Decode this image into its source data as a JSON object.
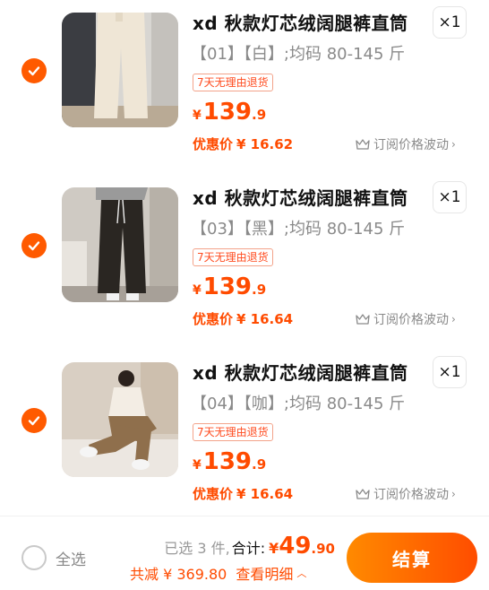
{
  "colors": {
    "accent": "#ff5a00",
    "price": "#ff4b00"
  },
  "items": [
    {
      "title": "xd 秋款灯芯绒阔腿裤直筒",
      "qty": "×1",
      "sku": "【01】【白】;均码 80-145 斤（",
      "tag": "7天无理由退货",
      "price_currency": "¥",
      "price_int": "139",
      "price_dec": ".9",
      "promo_label": "优惠价",
      "promo_value": "¥ 16.62",
      "subscribe": "订阅价格波动",
      "pants_color": "#efe6d6"
    },
    {
      "title": "xd 秋款灯芯绒阔腿裤直筒",
      "qty": "×1",
      "sku": "【03】【黑】;均码 80-145 斤（",
      "tag": "7天无理由退货",
      "price_currency": "¥",
      "price_int": "139",
      "price_dec": ".9",
      "promo_label": "优惠价",
      "promo_value": "¥ 16.64",
      "subscribe": "订阅价格波动",
      "pants_color": "#2a2622"
    },
    {
      "title": "xd 秋款灯芯绒阔腿裤直筒",
      "qty": "×1",
      "sku": "【04】【咖】;均码 80-145 斤（",
      "tag": "7天无理由退货",
      "price_currency": "¥",
      "price_int": "139",
      "price_dec": ".9",
      "promo_label": "优惠价",
      "promo_value": "¥ 16.64",
      "subscribe": "订阅价格波动",
      "pants_color": "#8f6f4c"
    }
  ],
  "footer": {
    "select_all": "全选",
    "selected_count": "已选 3 件,",
    "total_label": "合计:",
    "total_currency": "¥",
    "total_int": "49",
    "total_dec": ".90",
    "discount": "共减 ¥ 369.80",
    "detail": "查看明细",
    "checkout": "结算"
  },
  "icons": {
    "check": "check-icon",
    "subscribe": "crown-icon",
    "arrow": "chevron-right-icon",
    "dropdown": "chevron-down-icon",
    "up": "chevron-up-icon"
  }
}
